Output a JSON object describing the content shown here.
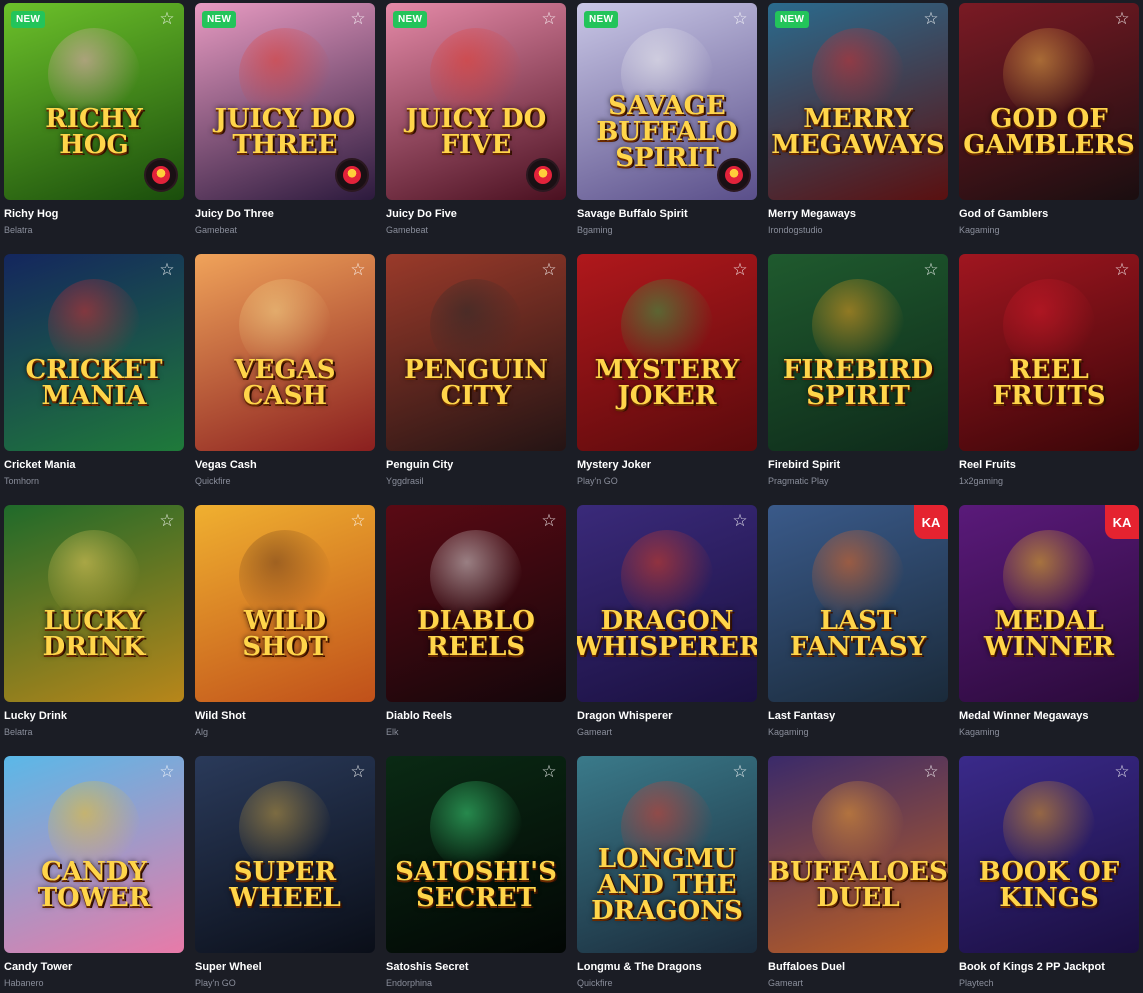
{
  "games": [
    {
      "name": "Richy Hog",
      "provider": "Belatra",
      "art": "Richy Hog",
      "is_new": true,
      "new_label": "NEW",
      "provider_badge": true,
      "ka_badge": false,
      "bg": [
        "#6cc12a",
        "#1a4d0c"
      ],
      "accent": "#f4a9c4"
    },
    {
      "name": "Juicy Do Three",
      "provider": "Gamebeat",
      "art": "Juicy Do Three",
      "is_new": true,
      "new_label": "NEW",
      "provider_badge": true,
      "ka_badge": false,
      "bg": [
        "#e89bc2",
        "#2c1a3d"
      ],
      "accent": "#e23b2f"
    },
    {
      "name": "Juicy Do Five",
      "provider": "Gamebeat",
      "art": "Juicy Do Five",
      "is_new": true,
      "new_label": "NEW",
      "provider_badge": true,
      "ka_badge": false,
      "bg": [
        "#e58aa8",
        "#4a1020"
      ],
      "accent": "#e23b2f"
    },
    {
      "name": "Savage Buffalo Spirit",
      "provider": "Bgaming",
      "art": "Savage Buffalo Spirit",
      "is_new": true,
      "new_label": "NEW",
      "provider_badge": true,
      "ka_badge": false,
      "bg": [
        "#c9c7e6",
        "#5a4f8a"
      ],
      "accent": "#f1f1f1"
    },
    {
      "name": "Merry Megaways",
      "provider": "Irondogstudio",
      "art": "Merry Megaways",
      "is_new": true,
      "new_label": "NEW",
      "provider_badge": false,
      "ka_badge": false,
      "bg": [
        "#2a6b8e",
        "#5a1010"
      ],
      "accent": "#d62d2d"
    },
    {
      "name": "God of Gamblers",
      "provider": "Kagaming",
      "art": "God of Gamblers",
      "is_new": false,
      "new_label": "",
      "provider_badge": false,
      "ka_badge": false,
      "bg": [
        "#7a1a24",
        "#1a0e10"
      ],
      "accent": "#e8b04a"
    },
    {
      "name": "Cricket Mania",
      "provider": "Tomhorn",
      "art": "Cricket Mania",
      "is_new": false,
      "new_label": "",
      "provider_badge": false,
      "ka_badge": false,
      "bg": [
        "#14265e",
        "#1f7a3a"
      ],
      "accent": "#d93030"
    },
    {
      "name": "Vegas Cash",
      "provider": "Quickfire",
      "art": "Vegas Cash",
      "is_new": false,
      "new_label": "",
      "provider_badge": false,
      "ka_badge": false,
      "bg": [
        "#f0a35a",
        "#8a1f1f"
      ],
      "accent": "#f3d58a"
    },
    {
      "name": "Penguin City",
      "provider": "Yggdrasil",
      "art": "Penguin City",
      "is_new": false,
      "new_label": "",
      "provider_badge": false,
      "ka_badge": false,
      "bg": [
        "#9a3a2a",
        "#241414"
      ],
      "accent": "#2a2a2a"
    },
    {
      "name": "Mystery Joker",
      "provider": "Play'n GO",
      "art": "Mystery Joker",
      "is_new": false,
      "new_label": "",
      "provider_badge": false,
      "ka_badge": false,
      "bg": [
        "#b0181c",
        "#5a0a0c"
      ],
      "accent": "#2fa84a"
    },
    {
      "name": "Firebird Spirit",
      "provider": "Pragmatic Play",
      "art": "Firebird Spirit",
      "is_new": false,
      "new_label": "",
      "provider_badge": false,
      "ka_badge": false,
      "bg": [
        "#1f5a2e",
        "#0e2a1a"
      ],
      "accent": "#f2a020"
    },
    {
      "name": "Reel Fruits",
      "provider": "1x2gaming",
      "art": "Reel Fruits",
      "is_new": false,
      "new_label": "",
      "provider_badge": false,
      "ka_badge": false,
      "bg": [
        "#a01620",
        "#3a0608"
      ],
      "accent": "#d41a2a"
    },
    {
      "name": "Lucky Drink",
      "provider": "Belatra",
      "art": "Lucky Drink",
      "is_new": false,
      "new_label": "",
      "provider_badge": false,
      "ka_badge": false,
      "bg": [
        "#1f6a2a",
        "#b8861a"
      ],
      "accent": "#f0d060"
    },
    {
      "name": "Wild Shot",
      "provider": "Alg",
      "art": "Wild Shot",
      "is_new": false,
      "new_label": "",
      "provider_badge": false,
      "ka_badge": false,
      "bg": [
        "#f0b030",
        "#c0501a"
      ],
      "accent": "#6a3a1a"
    },
    {
      "name": "Diablo Reels",
      "provider": "Elk",
      "art": "Diablo Reels",
      "is_new": false,
      "new_label": "",
      "provider_badge": false,
      "ka_badge": false,
      "bg": [
        "#5a0a14",
        "#14060a"
      ],
      "accent": "#e0e0e0"
    },
    {
      "name": "Dragon Whisperer",
      "provider": "Gameart",
      "art": "Dragon Whisperer",
      "is_new": false,
      "new_label": "",
      "provider_badge": false,
      "ka_badge": false,
      "bg": [
        "#3a2a7a",
        "#1a1040"
      ],
      "accent": "#e04020"
    },
    {
      "name": "Last Fantasy",
      "provider": "Kagaming",
      "art": "Last Fantasy",
      "is_new": false,
      "new_label": "",
      "provider_badge": false,
      "ka_badge": true,
      "ka_label": "KA",
      "bg": [
        "#3a5a8a",
        "#1a2a3a"
      ],
      "accent": "#f06a20"
    },
    {
      "name": "Medal Winner Megaways",
      "provider": "Kagaming",
      "art": "Medal Winner",
      "is_new": false,
      "new_label": "",
      "provider_badge": false,
      "ka_badge": true,
      "ka_label": "KA",
      "bg": [
        "#5a1a7a",
        "#2a0a3a"
      ],
      "accent": "#f2c020"
    },
    {
      "name": "Candy Tower",
      "provider": "Habanero",
      "art": "Candy Tower",
      "is_new": false,
      "new_label": "",
      "provider_badge": false,
      "ka_badge": false,
      "bg": [
        "#5ab8e8",
        "#e87aa8"
      ],
      "accent": "#f5c020"
    },
    {
      "name": "Super Wheel",
      "provider": "Play'n GO",
      "art": "Super Wheel",
      "is_new": false,
      "new_label": "",
      "provider_badge": false,
      "ka_badge": false,
      "bg": [
        "#2a3a5a",
        "#0a0e18"
      ],
      "accent": "#c8a040"
    },
    {
      "name": "Satoshis Secret",
      "provider": "Endorphina",
      "art": "Satoshi's Secret",
      "is_new": false,
      "new_label": "",
      "provider_badge": false,
      "ka_badge": false,
      "bg": [
        "#0a2a14",
        "#020604"
      ],
      "accent": "#40e080"
    },
    {
      "name": "Longmu & The Dragons",
      "provider": "Quickfire",
      "art": "Longmu and the Dragons",
      "is_new": false,
      "new_label": "",
      "provider_badge": false,
      "ka_badge": false,
      "bg": [
        "#3a7a8a",
        "#1a2a3a"
      ],
      "accent": "#e03a2a"
    },
    {
      "name": "Buffaloes Duel",
      "provider": "Gameart",
      "art": "Buffaloes Duel",
      "is_new": false,
      "new_label": "",
      "provider_badge": false,
      "ka_badge": false,
      "bg": [
        "#3a2a6a",
        "#c06020"
      ],
      "accent": "#f0a030"
    },
    {
      "name": "Book of Kings 2 PP Jackpot",
      "provider": "Playtech",
      "art": "Book of Kings",
      "is_new": false,
      "new_label": "",
      "provider_badge": false,
      "ka_badge": false,
      "bg": [
        "#3a2a8a",
        "#1a0e40"
      ],
      "accent": "#e8a020"
    }
  ],
  "favorite_icon": "star-outline-icon",
  "colors": {
    "page_bg": "#1b1d25",
    "new_badge": "#23c45a",
    "title_text": "#ffffff",
    "provider_text": "#8a8e9b"
  }
}
